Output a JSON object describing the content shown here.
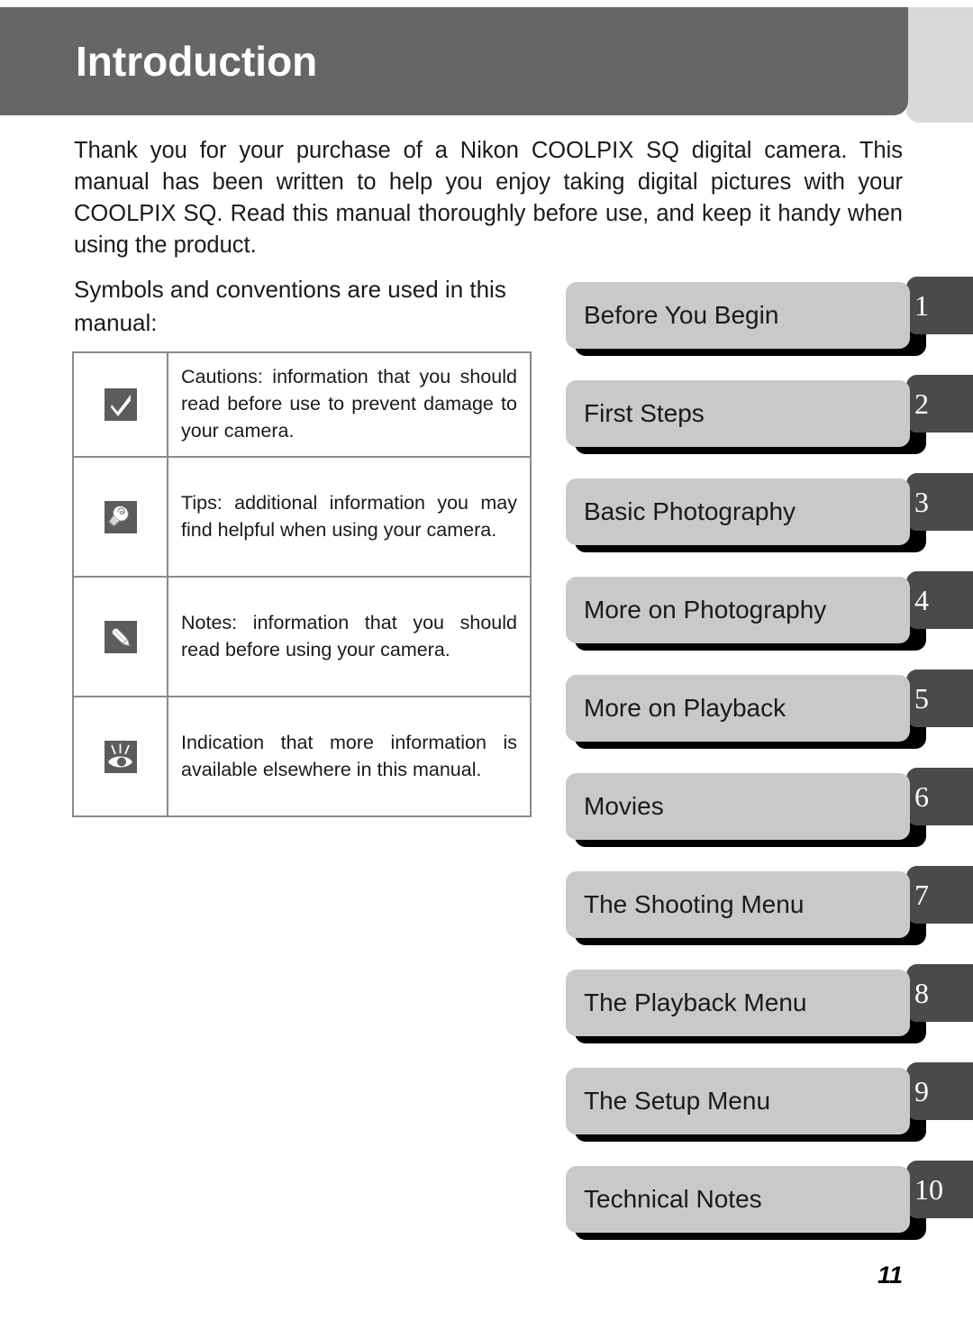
{
  "header": {
    "title": "Introduction",
    "band_color": "#666666",
    "edge_color": "#d9d9d9"
  },
  "intro": {
    "paragraph": "Thank you for your purchase of a Nikon COOLPIX SQ digital camera. This manual has been written to help you enjoy taking digital pictures with your COOLPIX SQ. Read this manual thoroughly before use, and keep it handy when using the product."
  },
  "symbols": {
    "heading": "Symbols and conventions are used in this manual:",
    "rows": [
      {
        "icon": "checkmark-icon",
        "text": "Cautions: information that you should read before use to prevent damage to your camera."
      },
      {
        "icon": "lightbulb-icon",
        "text": "Tips: additional information you may find helpful when using your camera."
      },
      {
        "icon": "pencil-icon",
        "text": "Notes: information that you should read before using your camera."
      },
      {
        "icon": "eye-icon",
        "text": "Indication that more information is available elsewhere in this manual."
      }
    ]
  },
  "chapters": {
    "tabs": [
      {
        "label": "Before You Begin",
        "number": "1"
      },
      {
        "label": "First Steps",
        "number": "2"
      },
      {
        "label": "Basic Photography",
        "number": "3"
      },
      {
        "label": "More on Photography",
        "number": "4"
      },
      {
        "label": "More on Playback",
        "number": "5"
      },
      {
        "label": "Movies",
        "number": "6"
      },
      {
        "label": "The Shooting Menu",
        "number": "7"
      },
      {
        "label": "The Playback Menu",
        "number": "8"
      },
      {
        "label": "The Setup Menu",
        "number": "9"
      },
      {
        "label": "Technical Notes",
        "number": "10"
      }
    ],
    "tab_color": "#c9c9c9",
    "number_box_color": "#4a4a4a"
  },
  "footer": {
    "page_number": "11"
  }
}
